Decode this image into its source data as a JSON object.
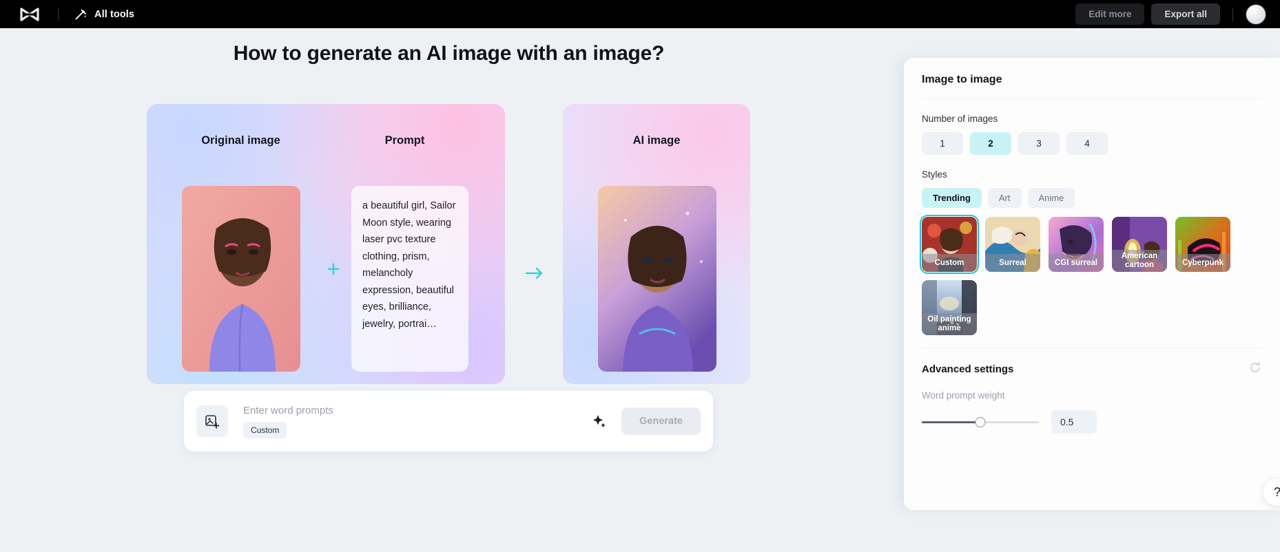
{
  "topbar": {
    "logo_icon": "capcut-logo-icon",
    "wand_icon": "magic-wand-icon",
    "all_tools_label": "All tools",
    "edit_more_label": "Edit more",
    "export_all_label": "Export all",
    "avatar_icon": "user-avatar"
  },
  "main": {
    "headline": "How to generate an AI image with an image?",
    "left_card": {
      "original_title": "Original image",
      "prompt_title": "Prompt",
      "prompt_text": "a beautiful girl, Sailor Moon style, wearing laser pvc texture clothing, prism, melancholy expression, beautiful eyes, brilliance, jewelry, portrai…",
      "plus_symbol": "+",
      "plus_color": "#2cd3e0"
    },
    "arrow_icon": "arrow-right-icon",
    "arrow_color": "#2cd3e0",
    "right_card": {
      "ai_title": "AI image"
    }
  },
  "prompt_bar": {
    "add_image_icon": "add-image-icon",
    "placeholder": "Enter word prompts",
    "chip_label": "Custom",
    "magic_icon": "sparkle-icon",
    "generate_label": "Generate"
  },
  "panel": {
    "title": "Image to image",
    "number_of_images_label": "Number of images",
    "number_options": [
      "1",
      "2",
      "3",
      "4"
    ],
    "number_selected": "2",
    "styles_label": "Styles",
    "style_tabs": [
      "Trending",
      "Art",
      "Anime"
    ],
    "style_tab_selected": "Trending",
    "styles": [
      {
        "name": "Custom",
        "selected": true
      },
      {
        "name": "Surreal",
        "selected": false
      },
      {
        "name": "CGI surreal",
        "selected": false
      },
      {
        "name": "American cartoon",
        "selected": false
      },
      {
        "name": "Cyberpunk",
        "selected": false
      },
      {
        "name": "Oil painting anime",
        "selected": false
      }
    ],
    "advanced_settings_label": "Advanced settings",
    "reset_icon": "reset-icon",
    "word_prompt_weight_label": "Word prompt weight",
    "word_prompt_weight_value": "0.5",
    "slider_percent": 50,
    "help_icon": "question-mark-icon",
    "accent_color": "#16c8dc",
    "selected_pill_color": "#c8f3f5"
  }
}
